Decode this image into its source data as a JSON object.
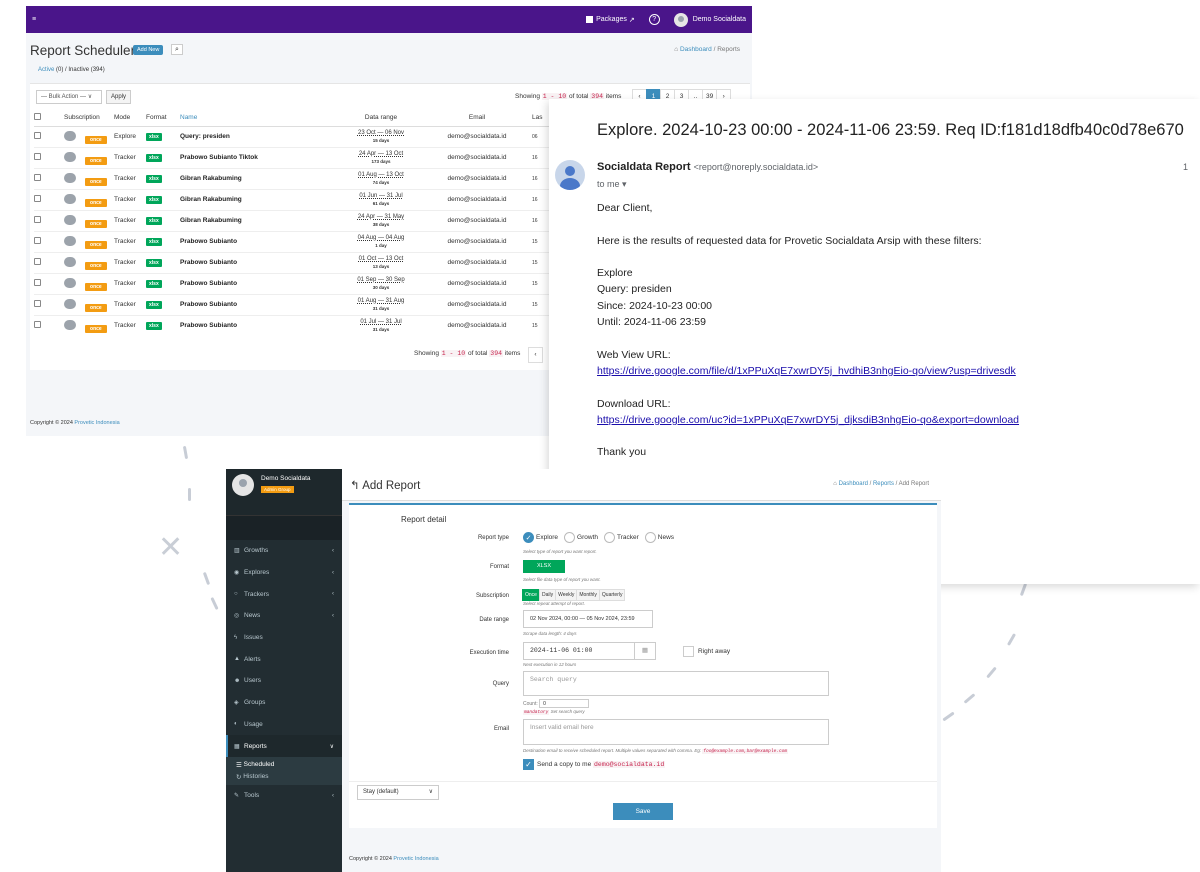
{
  "report_list": {
    "brand_menu": "≡",
    "packages": "Packages",
    "packages_ext": "↗",
    "help": "?",
    "user": "Demo Socialdata",
    "title": "Report Schedulers",
    "add_new": "Add New",
    "search_icon": "⌕",
    "breadcrumb": {
      "dashboard": "Dashboard",
      "sep": "/",
      "current": "Reports"
    },
    "tabs": {
      "active": "Active",
      "active_count": "(0)",
      "sep": "/",
      "inactive": "Inactive (394)"
    },
    "bulk_action": "— Bulk Action —",
    "bulk_caret": "∨",
    "apply": "Apply",
    "showing": {
      "prefix": "Showing",
      "range": "1 - 10",
      "mid": "of total",
      "total": "394",
      "suffix": "items"
    },
    "pages": [
      "‹",
      "1",
      "2",
      "3",
      "..",
      "39",
      "›"
    ],
    "columns": [
      "Subscription",
      "Mode",
      "Format",
      "Name",
      "Data range",
      "Email",
      "Las"
    ],
    "rows": [
      {
        "sub": "once",
        "mode": "Explore",
        "fmt": "xlsx",
        "name": "Query: presiden",
        "range": "23 Oct — 06 Nov",
        "days": "15 days",
        "email": "demo@socialdata.id",
        "last": "06"
      },
      {
        "sub": "once",
        "mode": "Tracker",
        "fmt": "xlsx",
        "name": "Prabowo Subianto Tiktok",
        "range": "24 Apr — 13 Oct",
        "days": "173 days",
        "email": "demo@socialdata.id",
        "last": "16"
      },
      {
        "sub": "once",
        "mode": "Tracker",
        "fmt": "xlsx",
        "name": "Gibran Rakabuming",
        "range": "01 Aug — 13 Oct",
        "days": "74 days",
        "email": "demo@socialdata.id",
        "last": "16"
      },
      {
        "sub": "once",
        "mode": "Tracker",
        "fmt": "xlsx",
        "name": "Gibran Rakabuming",
        "range": "01 Jun — 31 Jul",
        "days": "61 days",
        "email": "demo@socialdata.id",
        "last": "16"
      },
      {
        "sub": "once",
        "mode": "Tracker",
        "fmt": "xlsx",
        "name": "Gibran Rakabuming",
        "range": "24 Apr — 31 May",
        "days": "38 days",
        "email": "demo@socialdata.id",
        "last": "16"
      },
      {
        "sub": "once",
        "mode": "Tracker",
        "fmt": "xlsx",
        "name": "Prabowo Subianto",
        "range": "04 Aug — 04 Aug",
        "days": "1 day",
        "email": "demo@socialdata.id",
        "last": "15"
      },
      {
        "sub": "once",
        "mode": "Tracker",
        "fmt": "xlsx",
        "name": "Prabowo Subianto",
        "range": "01 Oct — 13 Oct",
        "days": "13 days",
        "email": "demo@socialdata.id",
        "last": "15"
      },
      {
        "sub": "once",
        "mode": "Tracker",
        "fmt": "xlsx",
        "name": "Prabowo Subianto",
        "range": "01 Sep — 30 Sep",
        "days": "30 days",
        "email": "demo@socialdata.id",
        "last": "15"
      },
      {
        "sub": "once",
        "mode": "Tracker",
        "fmt": "xlsx",
        "name": "Prabowo Subianto",
        "range": "01 Aug — 31 Aug",
        "days": "31 days",
        "email": "demo@socialdata.id",
        "last": "15"
      },
      {
        "sub": "once",
        "mode": "Tracker",
        "fmt": "xlsx",
        "name": "Prabowo Subianto",
        "range": "01 Jul — 31 Jul",
        "days": "31 days",
        "email": "demo@socialdata.id",
        "last": "15"
      }
    ],
    "footer_page": "‹",
    "copyright": "Copyright © 2024",
    "company": "Provetic Indonesia"
  },
  "email": {
    "subject": "Explore. 2024-10-23 00:00 - 2024-11-06 23:59. Req ID:f181d18dfb40c0d78e670",
    "sender_name": "Socialdata Report",
    "sender_addr": "<report@noreply.socialdata.id>",
    "time": "1",
    "to": "to me ▾",
    "greeting": "Dear Client,",
    "intro": "Here is the results of requested data for Provetic Socialdata Arsip with these filters:",
    "filters": [
      "Explore",
      "Query: presiden",
      "Since: 2024-10-23 00:00",
      "Until: 2024-11-06 23:59"
    ],
    "web_label": "Web View URL:",
    "web_url": "https://drive.google.com/file/d/1xPPuXqE7xwrDY5j_hvdhiB3nhgEio-qo/view?usp=drivesdk",
    "dl_label": "Download URL:",
    "dl_url": "https://drive.google.com/uc?id=1xPPuXqE7xwrDY5j_djksdiB3nhgEio-qo&export=download",
    "thanks": "Thank you"
  },
  "add_report": {
    "user": "Demo Socialdata",
    "badge": "Admin Group",
    "menu": [
      {
        "icon": "▥",
        "label": "Growths",
        "caret": "‹"
      },
      {
        "icon": "◉",
        "label": "Explores",
        "caret": "‹"
      },
      {
        "icon": "○",
        "label": "Trackers",
        "caret": "‹"
      },
      {
        "icon": "◎",
        "label": "News",
        "caret": "‹"
      },
      {
        "icon": "ϟ",
        "label": "Issues",
        "caret": ""
      },
      {
        "icon": "▲",
        "label": "Alerts",
        "caret": ""
      },
      {
        "icon": "☻",
        "label": "Users",
        "caret": ""
      },
      {
        "icon": "◈",
        "label": "Groups",
        "caret": ""
      },
      {
        "icon": "◐",
        "label": "Usage",
        "caret": ""
      },
      {
        "icon": "▦",
        "label": "Reports",
        "caret": "∨"
      }
    ],
    "sub_menu": [
      {
        "icon": "☰",
        "label": "Scheduled"
      },
      {
        "icon": "↻",
        "label": "Histories"
      }
    ],
    "tools": {
      "icon": "✎",
      "label": "Tools",
      "caret": "‹"
    },
    "back": "↰",
    "title": "Add Report",
    "breadcrumb": {
      "dashboard": "Dashboard",
      "reports": "Reports",
      "current": "Add Report",
      "sep": "/"
    },
    "section": "Report detail",
    "report_type": {
      "label": "Report type",
      "options": [
        "Explore",
        "Growth",
        "Tracker",
        "News"
      ],
      "help": "Select type of report you want report."
    },
    "format": {
      "label": "Format",
      "value": "XLSX",
      "help": "Select file data type of report you want."
    },
    "subscription": {
      "label": "Subscription",
      "options": [
        "Once",
        "Daily",
        "Weekly",
        "Monthly",
        "Quarterly"
      ],
      "help": "Select repeat attempt of report."
    },
    "date_range": {
      "label": "Date range",
      "value": "02 Nov 2024, 00:00 — 05 Nov 2024, 23:59",
      "help": "Scrape data length: 4 days"
    },
    "execution": {
      "label": "Execution time",
      "value": "2024-11-06 01:00",
      "help": "Next execution in 12 hours",
      "right_away": "Right away",
      "cal": "▦"
    },
    "query": {
      "label": "Query",
      "placeholder": "Search query",
      "count_label": "Count:",
      "count": "0",
      "mandatory": "mandatory",
      "help": "Set search query"
    },
    "email": {
      "label": "Email",
      "placeholder": "Insert valid email here",
      "help": "Destination email to receive scheduled report. Multiple values separated with comma. Eg:",
      "example": "foo@example.com,bar@example.com"
    },
    "copy": {
      "label": "Send a copy to me",
      "email": "demo@socialdata.id",
      "check": "✓"
    },
    "stay": "Stay (default)",
    "stay_caret": "∨",
    "save": "Save",
    "copyright": "Copyright © 2024",
    "company": "Provetic Indonesia"
  }
}
